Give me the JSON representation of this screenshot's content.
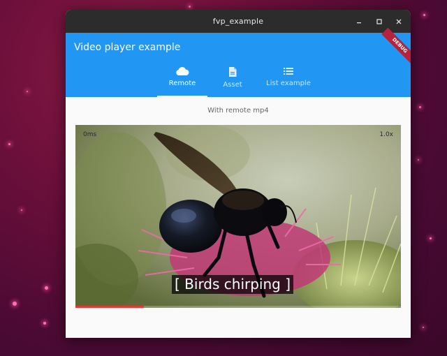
{
  "window": {
    "title": "fvp_example"
  },
  "appbar": {
    "title": "Video player example",
    "banner": "DEBUG"
  },
  "tabs": [
    {
      "label": "Remote",
      "icon": "cloud-icon",
      "active": true
    },
    {
      "label": "Asset",
      "icon": "document-icon",
      "active": false
    },
    {
      "label": "List example",
      "icon": "list-icon",
      "active": false
    }
  ],
  "content": {
    "subtitle": "With remote mp4"
  },
  "video": {
    "position": "0ms",
    "speed": "1.0x",
    "caption": "[ Birds chirping ]",
    "progress_fraction": 0.21
  },
  "colors": {
    "appbar": "#2196f3",
    "titlebar": "#2c2c2c",
    "progress": "#e53935",
    "debug_banner": "#b5223a"
  }
}
